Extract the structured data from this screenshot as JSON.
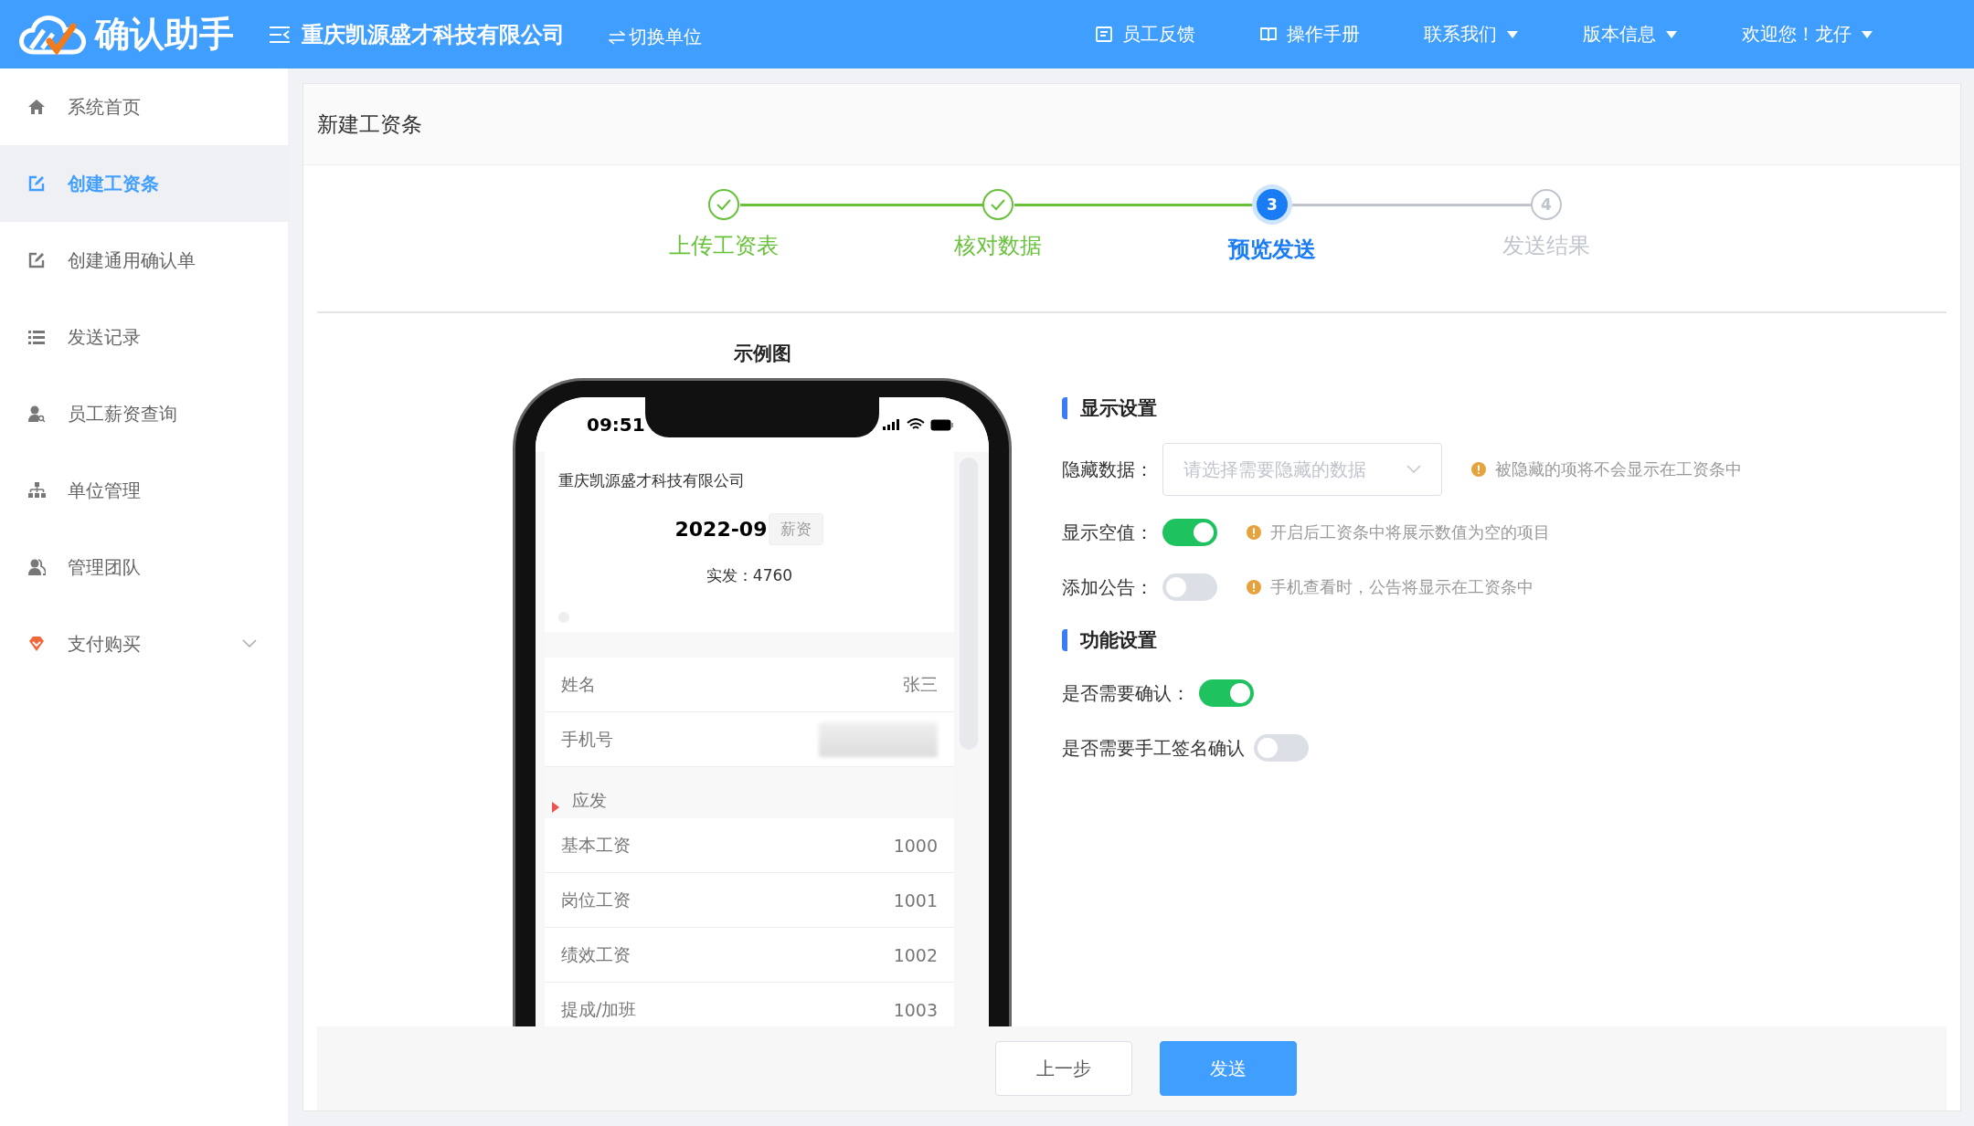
{
  "header": {
    "logo_text": "确认助手",
    "company": "重庆凯源盛才科技有限公司",
    "switch_label": "切换单位",
    "nav": [
      {
        "label": "员工反馈",
        "dropdown": false
      },
      {
        "label": "操作手册",
        "dropdown": false
      },
      {
        "label": "联系我们",
        "dropdown": true
      },
      {
        "label": "版本信息",
        "dropdown": true
      },
      {
        "label": "欢迎您！龙仔",
        "dropdown": true
      }
    ]
  },
  "sidebar": {
    "items": [
      {
        "label": "系统首页",
        "selected": false,
        "expandable": false
      },
      {
        "label": "创建工资条",
        "selected": true,
        "expandable": false
      },
      {
        "label": "创建通用确认单",
        "selected": false,
        "expandable": false
      },
      {
        "label": "发送记录",
        "selected": false,
        "expandable": false
      },
      {
        "label": "员工薪资查询",
        "selected": false,
        "expandable": false
      },
      {
        "label": "单位管理",
        "selected": false,
        "expandable": false
      },
      {
        "label": "管理团队",
        "selected": false,
        "expandable": false
      },
      {
        "label": "支付购买",
        "selected": false,
        "expandable": true
      }
    ]
  },
  "page": {
    "title": "新建工资条",
    "steps": [
      {
        "label": "上传工资表",
        "done": true,
        "selected": false
      },
      {
        "label": "核对数据",
        "done": true,
        "selected": false
      },
      {
        "label": "预览发送",
        "number": "3",
        "done": false,
        "selected": true
      },
      {
        "label": "发送结果",
        "number": "4",
        "done": false,
        "selected": false
      }
    ],
    "preview": {
      "title": "示例图",
      "time": "09:51",
      "company": "重庆凯源盛才科技有限公司",
      "period": "2022-09",
      "tag": "薪资",
      "net_pay": "实发：4760",
      "rows": [
        {
          "kind": "row",
          "label": "姓名",
          "value": "张三"
        },
        {
          "kind": "hidden",
          "label": "手机号"
        },
        {
          "kind": "section",
          "label": "应发"
        },
        {
          "kind": "row",
          "label": "基本工资",
          "value": "1000"
        },
        {
          "kind": "row",
          "label": "岗位工资",
          "value": "1001"
        },
        {
          "kind": "row",
          "label": "绩效工资",
          "value": "1002"
        },
        {
          "kind": "row",
          "label": "提成/加班",
          "value": "1003"
        }
      ]
    },
    "settings": [
      {
        "kind": "heading",
        "label": "显示设置"
      },
      {
        "kind": "select",
        "label": "隐藏数据：",
        "placeholder": "请选择需要隐藏的数据",
        "hint": "被隐藏的项将不会显示在工资条中"
      },
      {
        "kind": "switch",
        "label": "显示空值：",
        "on": true,
        "hint": "开启后工资条中将展示数值为空的项目"
      },
      {
        "kind": "switch",
        "label": "添加公告：",
        "on": false,
        "hint": "手机查看时，公告将显示在工资条中"
      },
      {
        "kind": "heading",
        "label": "功能设置"
      },
      {
        "kind": "switch",
        "label": "是否需要确认：",
        "on": true
      },
      {
        "kind": "switch",
        "label": "是否需要手工签名确认",
        "on": false
      }
    ],
    "buttons": [
      {
        "label": "上一步",
        "primary": false
      },
      {
        "label": "发送",
        "primary": true
      }
    ]
  }
}
